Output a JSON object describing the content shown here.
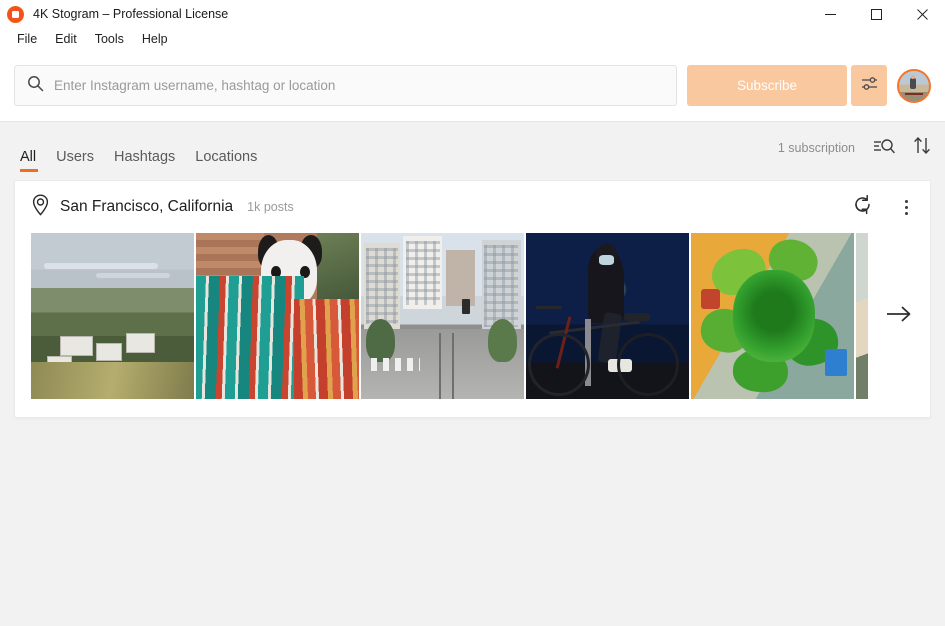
{
  "window": {
    "title": "4K Stogram – Professional License",
    "app_icon": "camera-ring-icon",
    "controls": {
      "minimize": "minimize-icon",
      "maximize": "maximize-icon",
      "close": "close-icon"
    }
  },
  "menubar": {
    "items": [
      {
        "label": "File"
      },
      {
        "label": "Edit"
      },
      {
        "label": "Tools"
      },
      {
        "label": "Help"
      }
    ]
  },
  "search": {
    "icon": "search-icon",
    "placeholder": "Enter Instagram username, hashtag or location",
    "value": "",
    "subscribe_label": "Subscribe",
    "settings_icon": "sliders-icon",
    "avatar": "user-avatar",
    "accent_peach": "#fac89f",
    "accent_orange": "#f26c21"
  },
  "tabs": {
    "items": [
      {
        "label": "All",
        "active": true
      },
      {
        "label": "Users",
        "active": false
      },
      {
        "label": "Hashtags",
        "active": false
      },
      {
        "label": "Locations",
        "active": false
      }
    ],
    "subscription_count": "1 subscription",
    "filter_icon": "filter-search-icon",
    "sort_icon": "sort-arrows-icon"
  },
  "card": {
    "location_icon": "location-pin-icon",
    "title": "San Francisco, California",
    "posts": "1k posts",
    "refresh_icon": "refresh-icon",
    "menu_icon": "more-vertical-icon",
    "next_icon": "arrow-right-icon",
    "thumbnails": [
      {
        "alt": "Hillside houses overlooking the bay"
      },
      {
        "alt": "Dog wrapped in a colorful striped blanket"
      },
      {
        "alt": "Downtown street with cable car tracks"
      },
      {
        "alt": "Cyclist at night wearing a mask"
      },
      {
        "alt": "Green succulent plant"
      },
      {
        "alt": "Partially visible photo"
      }
    ]
  }
}
